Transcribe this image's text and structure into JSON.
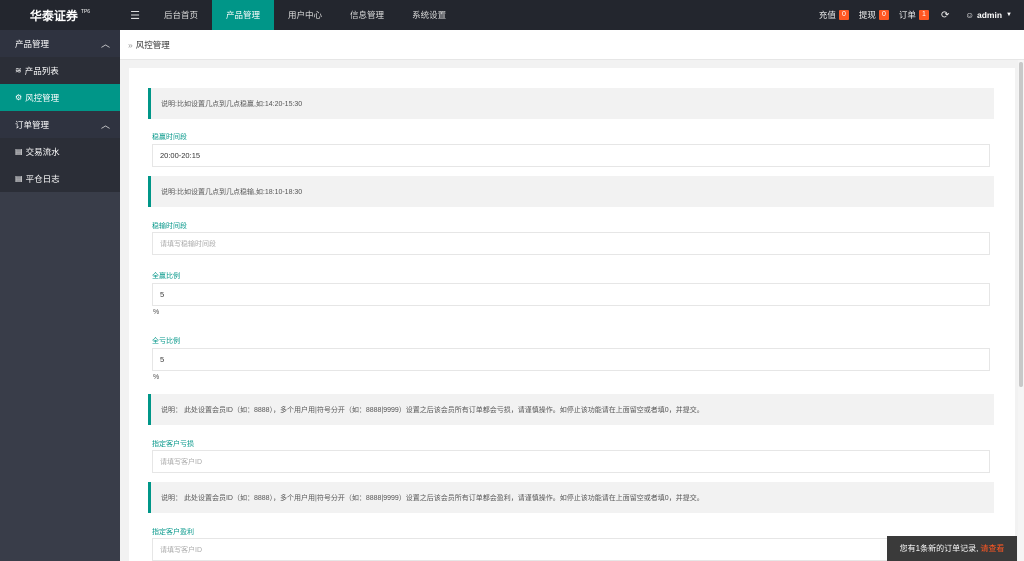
{
  "brand": {
    "name": "华泰证券",
    "version": "TP6"
  },
  "topnav": {
    "menu_icon": "hamburger-icon",
    "items": [
      "后台首页",
      "产品管理",
      "用户中心",
      "信息管理",
      "系统设置"
    ],
    "active_index": 1
  },
  "counters": [
    {
      "label": "充值",
      "count": "0"
    },
    {
      "label": "提现",
      "count": "0"
    },
    {
      "label": "订单",
      "count": "1"
    }
  ],
  "user": {
    "name": "admin",
    "icon": "user-icon"
  },
  "sidebar": {
    "groups": [
      {
        "label": "产品管理",
        "items": [
          {
            "label": "产品列表",
            "icon": "layers-icon"
          },
          {
            "label": "风控管理",
            "icon": "gear-icon",
            "active": true
          }
        ]
      },
      {
        "label": "订单管理",
        "items": [
          {
            "label": "交易流水",
            "icon": "list-icon"
          },
          {
            "label": "平仓日志",
            "icon": "list-icon"
          }
        ]
      }
    ]
  },
  "breadcrumb": {
    "sep": "»",
    "current": "风控管理"
  },
  "form": {
    "notice1": "说明:比如设置几点到几点稳赢,如:14:20-15:30",
    "win_time_label": "稳赢时间段",
    "win_time_value": "20:00-20:15",
    "notice2": "说明:比如设置几点到几点稳输,如:18:10-18:30",
    "lose_time_label": "稳输时间段",
    "lose_time_placeholder": "请填写稳输时间段",
    "win_ratio_label": "全赢比例",
    "win_ratio_value": "5",
    "win_ratio_unit": "%",
    "lose_ratio_label": "全亏比例",
    "lose_ratio_value": "5",
    "lose_ratio_unit": "%",
    "notice3": "说明： 此处设置会员ID（如：8888），多个用户用|符号分开（如：8888|9999）设置之后该会员所有订单都会亏损，请谨慎操作。如停止该功能请在上面留空或者填0，并提交。",
    "lose_user_label": "指定客户亏损",
    "lose_user_placeholder": "请填写客户ID",
    "notice4": "说明： 此处设置会员ID（如：8888），多个用户用|符号分开（如：8888|9999）设置之后该会员所有订单都会盈利，请谨慎操作。如停止该功能请在上面留空或者填0，并提交。",
    "win_user_label": "指定客户盈利",
    "win_user_placeholder": "请填写客户ID"
  },
  "toast": {
    "text": "您有1条新的订单记录,",
    "link": "请查看"
  }
}
